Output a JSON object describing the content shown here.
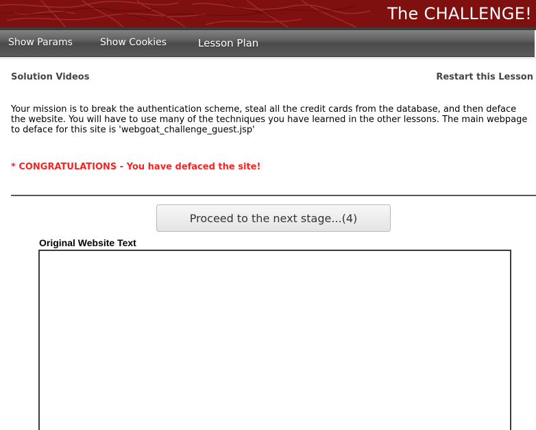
{
  "header": {
    "title": "The CHALLENGE!",
    "accent_color": "#8a1212"
  },
  "nav": {
    "items": [
      {
        "label": "Show Params"
      },
      {
        "label": "Show Cookies"
      },
      {
        "label": "Lesson Plan"
      }
    ]
  },
  "links": {
    "solution_videos": "Solution Videos",
    "restart_lesson": "Restart this Lesson"
  },
  "lesson": {
    "mission_text": "Your mission is to break the authentication scheme, steal all the credit cards from the database, and then deface the website. You will have to use many of the techniques you have learned in the other lessons. The main webpage to deface for this site is 'webgoat_challenge_guest.jsp'",
    "congrats_text": "* CONGRATULATIONS - You have defaced the site!",
    "congrats_color": "#ff2020",
    "proceed_label": "Proceed to the next stage...(4)",
    "original_text_label": "Original Website Text",
    "original_text_value": ""
  }
}
